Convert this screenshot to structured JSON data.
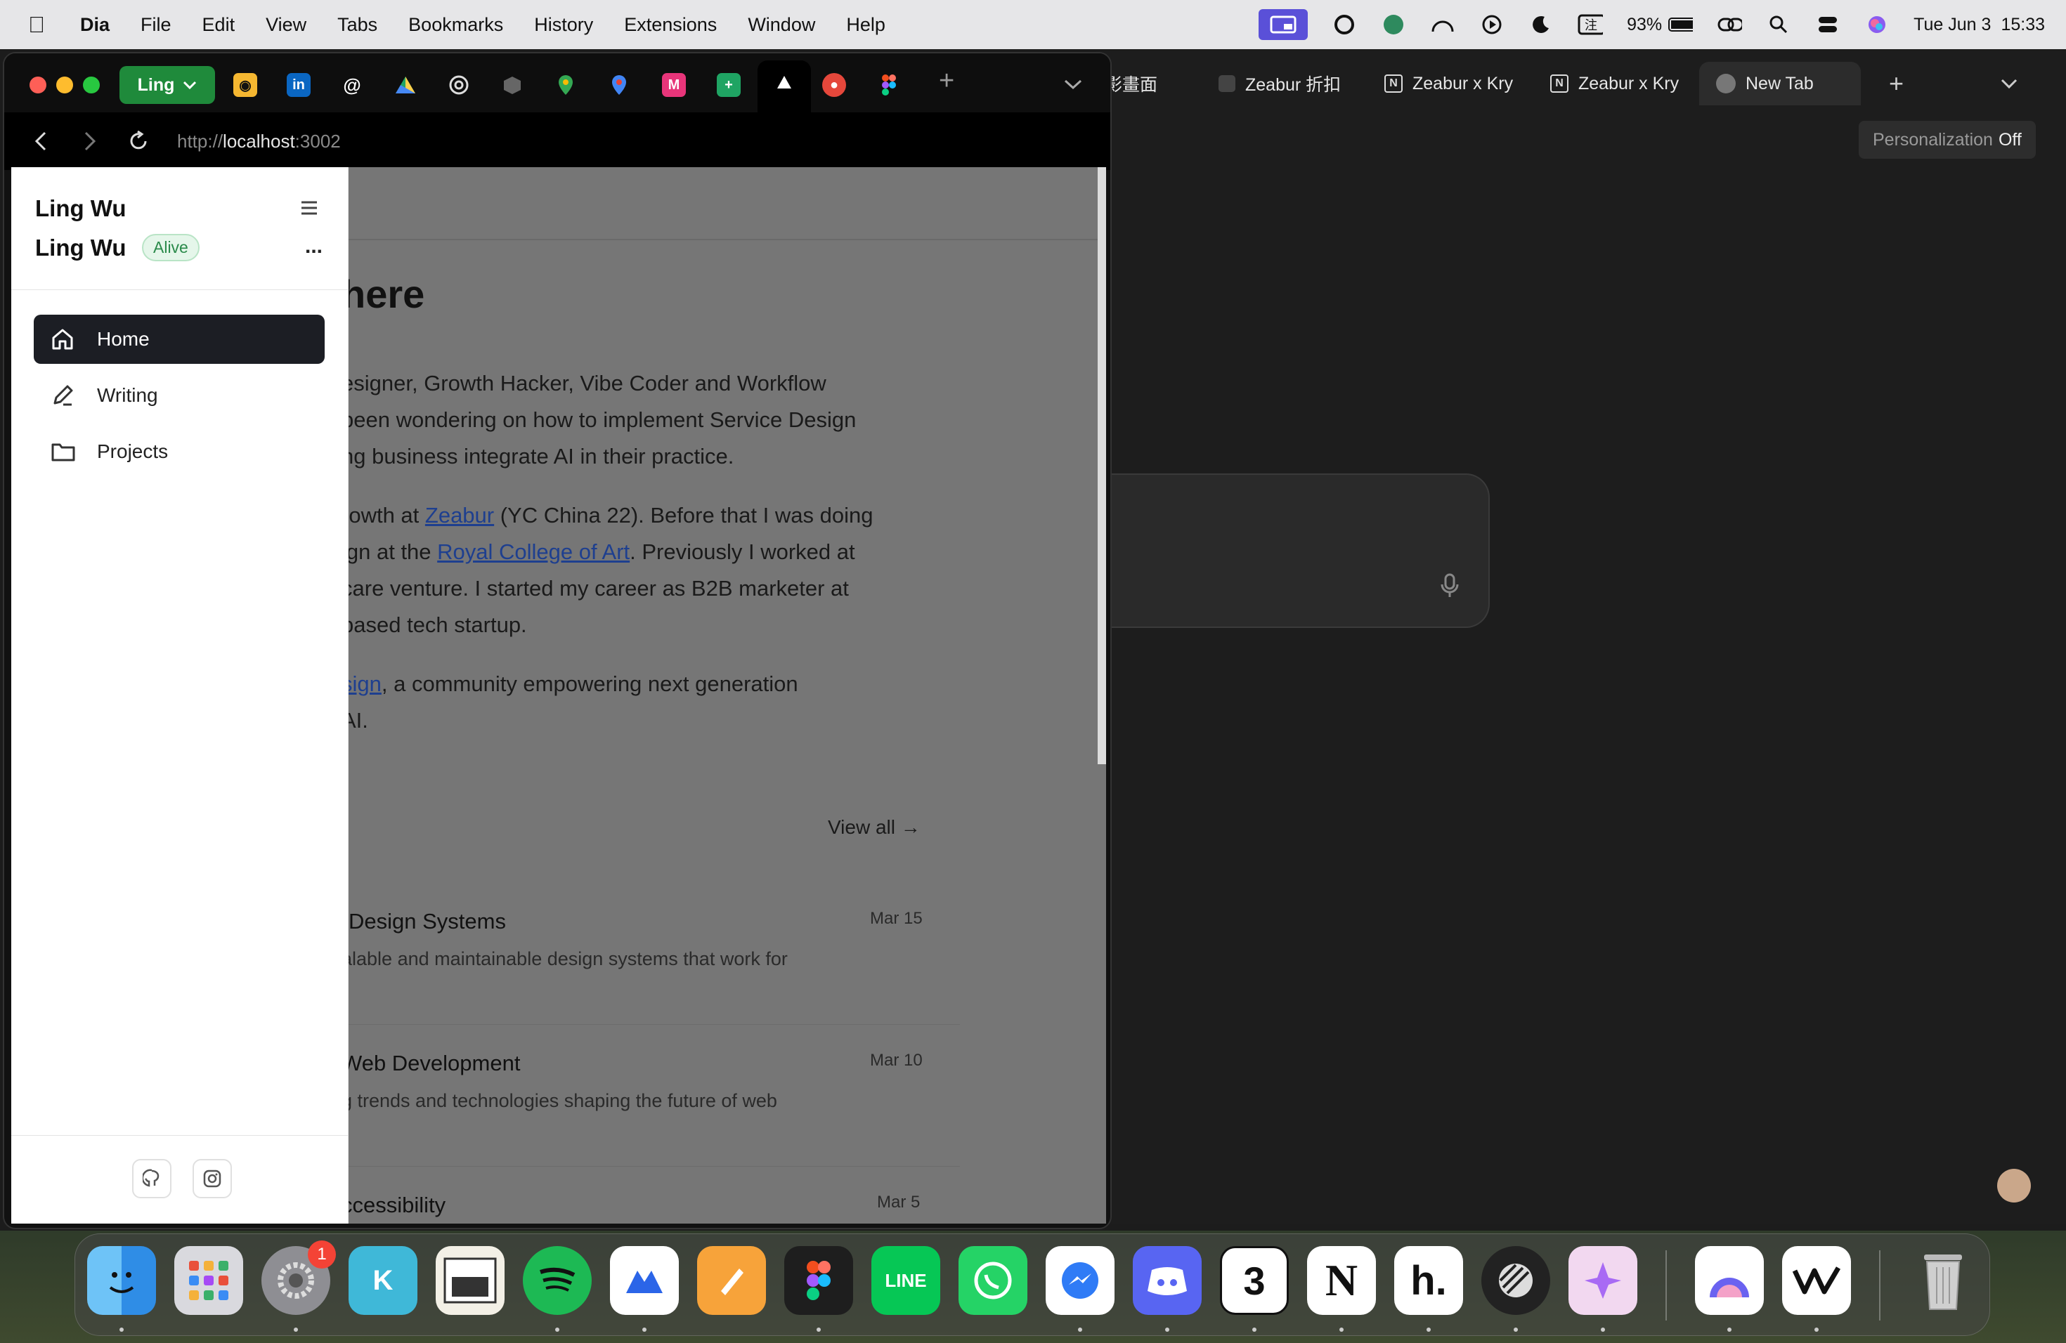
{
  "menubar": {
    "apple": "",
    "app": "Dia",
    "items": [
      "File",
      "Edit",
      "View",
      "Tabs",
      "Bookmarks",
      "History",
      "Extensions",
      "Window",
      "Help"
    ],
    "battery": "93%",
    "date": "Tue Jun 3",
    "time": "15:33"
  },
  "back_window": {
    "tabs": [
      {
        "label": "影畫面",
        "icon": "none"
      },
      {
        "label": "Zeabur 折扣",
        "icon": "generic-tab-icon"
      },
      {
        "label": "Zeabur x Kry",
        "icon": "notion-icon"
      },
      {
        "label": "Zeabur x Kry",
        "icon": "notion-icon"
      },
      {
        "label": "New Tab",
        "icon": "dia-icon"
      }
    ],
    "new_tab": "+",
    "personalization_label": "Personalization",
    "personalization_value": "Off"
  },
  "front_window": {
    "profile_label": "Ling",
    "url_scheme": "http://",
    "url_host": "localhost",
    "url_port": ":3002",
    "new_tab": "+"
  },
  "sidebar": {
    "title": "Ling Wu",
    "name": "Ling Wu",
    "status": "Alive",
    "more": "...",
    "nav": [
      {
        "label": "Home",
        "icon": "home-icon",
        "active": true
      },
      {
        "label": "Writing",
        "icon": "pen-icon",
        "active": false
      },
      {
        "label": "Projects",
        "icon": "folder-icon",
        "active": false
      }
    ]
  },
  "main": {
    "heading": "here",
    "intro1": [
      "esigner, Growth Hacker, Vibe Coder and Workflow",
      "been wondering on how to implement Service Design",
      "ng business integrate AI in their practice."
    ],
    "intro2_line1_pre": "rowth at ",
    "intro2_link1": "Zeabur",
    "intro2_line1_post": " (YC China 22). Before that I was doing",
    "intro2_line2_pre": "ign at the ",
    "intro2_link2": "Royal College of Art",
    "intro2_line2_post": ". Previously I worked at",
    "intro2_line3": "care venture. I started my career as B2B marketer at",
    "intro2_line4": "based tech startup.",
    "intro3_link": "sign",
    "intro3_line1_post": ", a community empowering next generation",
    "intro3_line2": "AI.",
    "view_all": "View all →",
    "posts": [
      {
        "title": "Design Systems",
        "desc": "alable and maintainable design systems that work for",
        "date": "Mar 15"
      },
      {
        "title": "Web Development",
        "desc": "g trends and technologies shaping the future of web",
        "date": "Mar 10"
      },
      {
        "title": "ccessibility",
        "desc": "",
        "date": "Mar 5"
      }
    ]
  },
  "dock": {
    "apps": [
      "Finder",
      "Launchpad",
      "System Settings",
      "Klokki",
      "Preview",
      "Spotify",
      "Mela",
      "Pages",
      "Figma",
      "LINE",
      "WhatsApp",
      "Messenger",
      "Discord",
      "Calendar",
      "Notion",
      "Hey",
      "Linear",
      "Spark",
      "Dia",
      "Wordly",
      "Trash"
    ],
    "settings_badge": "1",
    "calendar_day": "3"
  }
}
